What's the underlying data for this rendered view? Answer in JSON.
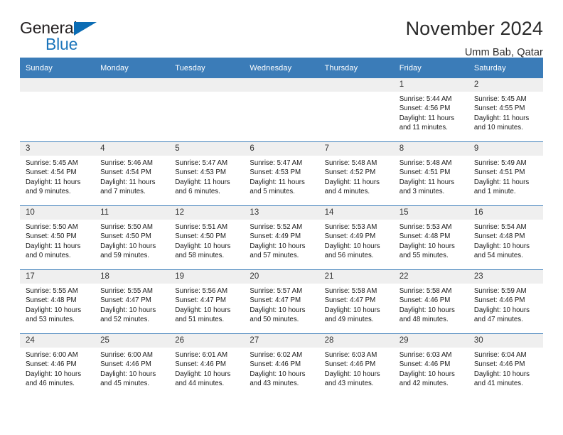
{
  "brand": {
    "name_part1": "General",
    "name_part2": "Blue",
    "triangle_color": "#0b6cb4",
    "blue_color": "#1b75bb"
  },
  "header": {
    "title": "November 2024",
    "subtitle": "Umm Bab, Qatar"
  },
  "theme": {
    "header_blue": "#3b7cb8",
    "daynum_gray": "#efefef"
  },
  "weekday_headers": [
    "Sunday",
    "Monday",
    "Tuesday",
    "Wednesday",
    "Thursday",
    "Friday",
    "Saturday"
  ],
  "weeks": [
    [
      {
        "day": "",
        "empty": true
      },
      {
        "day": "",
        "empty": true
      },
      {
        "day": "",
        "empty": true
      },
      {
        "day": "",
        "empty": true
      },
      {
        "day": "",
        "empty": true
      },
      {
        "day": "1",
        "sunrise": "Sunrise: 5:44 AM",
        "sunset": "Sunset: 4:56 PM",
        "daylight_line1": "Daylight: 11 hours",
        "daylight_line2": "and 11 minutes."
      },
      {
        "day": "2",
        "sunrise": "Sunrise: 5:45 AM",
        "sunset": "Sunset: 4:55 PM",
        "daylight_line1": "Daylight: 11 hours",
        "daylight_line2": "and 10 minutes."
      }
    ],
    [
      {
        "day": "3",
        "sunrise": "Sunrise: 5:45 AM",
        "sunset": "Sunset: 4:54 PM",
        "daylight_line1": "Daylight: 11 hours",
        "daylight_line2": "and 9 minutes."
      },
      {
        "day": "4",
        "sunrise": "Sunrise: 5:46 AM",
        "sunset": "Sunset: 4:54 PM",
        "daylight_line1": "Daylight: 11 hours",
        "daylight_line2": "and 7 minutes."
      },
      {
        "day": "5",
        "sunrise": "Sunrise: 5:47 AM",
        "sunset": "Sunset: 4:53 PM",
        "daylight_line1": "Daylight: 11 hours",
        "daylight_line2": "and 6 minutes."
      },
      {
        "day": "6",
        "sunrise": "Sunrise: 5:47 AM",
        "sunset": "Sunset: 4:53 PM",
        "daylight_line1": "Daylight: 11 hours",
        "daylight_line2": "and 5 minutes."
      },
      {
        "day": "7",
        "sunrise": "Sunrise: 5:48 AM",
        "sunset": "Sunset: 4:52 PM",
        "daylight_line1": "Daylight: 11 hours",
        "daylight_line2": "and 4 minutes."
      },
      {
        "day": "8",
        "sunrise": "Sunrise: 5:48 AM",
        "sunset": "Sunset: 4:51 PM",
        "daylight_line1": "Daylight: 11 hours",
        "daylight_line2": "and 3 minutes."
      },
      {
        "day": "9",
        "sunrise": "Sunrise: 5:49 AM",
        "sunset": "Sunset: 4:51 PM",
        "daylight_line1": "Daylight: 11 hours",
        "daylight_line2": "and 1 minute."
      }
    ],
    [
      {
        "day": "10",
        "sunrise": "Sunrise: 5:50 AM",
        "sunset": "Sunset: 4:50 PM",
        "daylight_line1": "Daylight: 11 hours",
        "daylight_line2": "and 0 minutes."
      },
      {
        "day": "11",
        "sunrise": "Sunrise: 5:50 AM",
        "sunset": "Sunset: 4:50 PM",
        "daylight_line1": "Daylight: 10 hours",
        "daylight_line2": "and 59 minutes."
      },
      {
        "day": "12",
        "sunrise": "Sunrise: 5:51 AM",
        "sunset": "Sunset: 4:50 PM",
        "daylight_line1": "Daylight: 10 hours",
        "daylight_line2": "and 58 minutes."
      },
      {
        "day": "13",
        "sunrise": "Sunrise: 5:52 AM",
        "sunset": "Sunset: 4:49 PM",
        "daylight_line1": "Daylight: 10 hours",
        "daylight_line2": "and 57 minutes."
      },
      {
        "day": "14",
        "sunrise": "Sunrise: 5:53 AM",
        "sunset": "Sunset: 4:49 PM",
        "daylight_line1": "Daylight: 10 hours",
        "daylight_line2": "and 56 minutes."
      },
      {
        "day": "15",
        "sunrise": "Sunrise: 5:53 AM",
        "sunset": "Sunset: 4:48 PM",
        "daylight_line1": "Daylight: 10 hours",
        "daylight_line2": "and 55 minutes."
      },
      {
        "day": "16",
        "sunrise": "Sunrise: 5:54 AM",
        "sunset": "Sunset: 4:48 PM",
        "daylight_line1": "Daylight: 10 hours",
        "daylight_line2": "and 54 minutes."
      }
    ],
    [
      {
        "day": "17",
        "sunrise": "Sunrise: 5:55 AM",
        "sunset": "Sunset: 4:48 PM",
        "daylight_line1": "Daylight: 10 hours",
        "daylight_line2": "and 53 minutes."
      },
      {
        "day": "18",
        "sunrise": "Sunrise: 5:55 AM",
        "sunset": "Sunset: 4:47 PM",
        "daylight_line1": "Daylight: 10 hours",
        "daylight_line2": "and 52 minutes."
      },
      {
        "day": "19",
        "sunrise": "Sunrise: 5:56 AM",
        "sunset": "Sunset: 4:47 PM",
        "daylight_line1": "Daylight: 10 hours",
        "daylight_line2": "and 51 minutes."
      },
      {
        "day": "20",
        "sunrise": "Sunrise: 5:57 AM",
        "sunset": "Sunset: 4:47 PM",
        "daylight_line1": "Daylight: 10 hours",
        "daylight_line2": "and 50 minutes."
      },
      {
        "day": "21",
        "sunrise": "Sunrise: 5:58 AM",
        "sunset": "Sunset: 4:47 PM",
        "daylight_line1": "Daylight: 10 hours",
        "daylight_line2": "and 49 minutes."
      },
      {
        "day": "22",
        "sunrise": "Sunrise: 5:58 AM",
        "sunset": "Sunset: 4:46 PM",
        "daylight_line1": "Daylight: 10 hours",
        "daylight_line2": "and 48 minutes."
      },
      {
        "day": "23",
        "sunrise": "Sunrise: 5:59 AM",
        "sunset": "Sunset: 4:46 PM",
        "daylight_line1": "Daylight: 10 hours",
        "daylight_line2": "and 47 minutes."
      }
    ],
    [
      {
        "day": "24",
        "sunrise": "Sunrise: 6:00 AM",
        "sunset": "Sunset: 4:46 PM",
        "daylight_line1": "Daylight: 10 hours",
        "daylight_line2": "and 46 minutes."
      },
      {
        "day": "25",
        "sunrise": "Sunrise: 6:00 AM",
        "sunset": "Sunset: 4:46 PM",
        "daylight_line1": "Daylight: 10 hours",
        "daylight_line2": "and 45 minutes."
      },
      {
        "day": "26",
        "sunrise": "Sunrise: 6:01 AM",
        "sunset": "Sunset: 4:46 PM",
        "daylight_line1": "Daylight: 10 hours",
        "daylight_line2": "and 44 minutes."
      },
      {
        "day": "27",
        "sunrise": "Sunrise: 6:02 AM",
        "sunset": "Sunset: 4:46 PM",
        "daylight_line1": "Daylight: 10 hours",
        "daylight_line2": "and 43 minutes."
      },
      {
        "day": "28",
        "sunrise": "Sunrise: 6:03 AM",
        "sunset": "Sunset: 4:46 PM",
        "daylight_line1": "Daylight: 10 hours",
        "daylight_line2": "and 43 minutes."
      },
      {
        "day": "29",
        "sunrise": "Sunrise: 6:03 AM",
        "sunset": "Sunset: 4:46 PM",
        "daylight_line1": "Daylight: 10 hours",
        "daylight_line2": "and 42 minutes."
      },
      {
        "day": "30",
        "sunrise": "Sunrise: 6:04 AM",
        "sunset": "Sunset: 4:46 PM",
        "daylight_line1": "Daylight: 10 hours",
        "daylight_line2": "and 41 minutes."
      }
    ]
  ]
}
